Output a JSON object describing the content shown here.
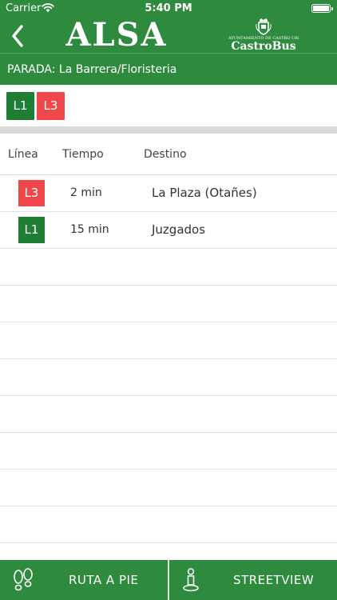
{
  "status_bar": {
    "carrier": "Carrier",
    "time": "5:40 PM",
    "wifi_icon": "wifi-icon",
    "battery_icon": "battery-icon"
  },
  "nav": {
    "back_icon": "chevron-left-icon",
    "logo_text": "ALSA",
    "partner_logo": {
      "small_text": "AYUNTAMIENTO DE CASTRO URDIALES",
      "name": "CastroBus",
      "icon": "crest-icon"
    }
  },
  "stop": {
    "label": "PARADA: La Barrera/Floristeria"
  },
  "line_chips": [
    {
      "label": "L1",
      "color": "#1e7e34"
    },
    {
      "label": "L3",
      "color": "#f0484a"
    }
  ],
  "table": {
    "headers": {
      "line": "Línea",
      "time": "Tiempo",
      "destination": "Destino"
    },
    "rows": [
      {
        "line": "L3",
        "color": "#f0484a",
        "time": "2 min",
        "destination": "La Plaza (Otañes)"
      },
      {
        "line": "L1",
        "color": "#1e7e34",
        "time": "15 min",
        "destination": "Juzgados"
      }
    ],
    "empty_rows": 9
  },
  "toolbar": {
    "walk_label": "RUTA A PIE",
    "walk_icon": "footprints-icon",
    "streetview_label": "STREETVIEW",
    "streetview_icon": "pegman-icon"
  },
  "colors": {
    "brand_green": "#2e8b3e",
    "line_l1": "#1e7e34",
    "line_l3": "#f0484a"
  }
}
